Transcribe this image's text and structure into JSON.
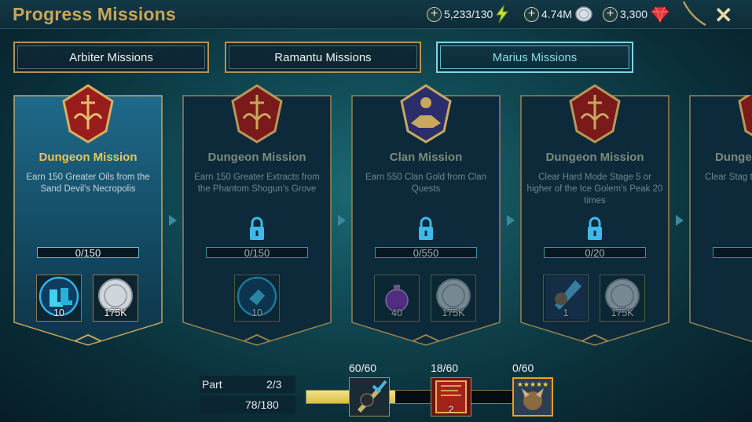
{
  "header": {
    "title": "Progress Missions",
    "close_label": "✕"
  },
  "resources": [
    {
      "value": "5,233/130",
      "icon": "energy-bolt-icon"
    },
    {
      "value": "4.74M",
      "icon": "silver-coin-icon"
    },
    {
      "value": "3,300",
      "icon": "ruby-gem-icon"
    }
  ],
  "tabs": [
    {
      "label": "Arbiter Missions",
      "active": false
    },
    {
      "label": "Ramantu Missions",
      "active": false
    },
    {
      "label": "Marius Missions",
      "active": true
    }
  ],
  "missions": [
    {
      "title": "Dungeon Mission",
      "description": "Earn 150 Greater Oils from the Sand Devil's Necropolis",
      "progress": "0/150",
      "locked": false,
      "emblem": "dungeon-crest-icon",
      "rewards": [
        {
          "icon": "boots-artifact-icon",
          "count": "10"
        },
        {
          "icon": "silver-coin-icon",
          "count": "175K"
        }
      ]
    },
    {
      "title": "Dungeon Mission",
      "description": "Earn 150 Greater Extracts from the Phantom Shogun's Grove",
      "progress": "0/150",
      "locked": true,
      "emblem": "dungeon-crest-icon",
      "rewards": [
        {
          "icon": "gloves-artifact-icon",
          "count": "10"
        }
      ]
    },
    {
      "title": "Clan Mission",
      "description": "Earn 550 Clan Gold from Clan Quests",
      "progress": "0/550",
      "locked": true,
      "emblem": "clan-handshake-crest-icon",
      "rewards": [
        {
          "icon": "purple-potion-icon",
          "count": "40"
        },
        {
          "icon": "silver-coin-icon",
          "count": "175K"
        }
      ]
    },
    {
      "title": "Dungeon Mission",
      "description": "Clear Hard Mode Stage 5 or higher of the Ice Golem's Peak 20 times",
      "progress": "0/20",
      "locked": true,
      "emblem": "dungeon-crest-icon",
      "rewards": [
        {
          "icon": "champion-portrait-icon",
          "count": "1"
        },
        {
          "icon": "silver-coin-icon",
          "count": "175K"
        }
      ]
    },
    {
      "title": "Dunge",
      "description": "Clear Stag the Iron T",
      "progress": "",
      "locked": true,
      "emblem": "dungeon-crest-icon",
      "rewards": []
    }
  ],
  "footer": {
    "part_label": "Part",
    "part_value": "2/3",
    "points": "78/180",
    "milestones": [
      {
        "count": "60/60",
        "icon": "weapon-artifact-icon",
        "badge": "",
        "claimed": true
      },
      {
        "count": "18/60",
        "icon": "red-tome-icon",
        "badge": "2",
        "claimed": false
      },
      {
        "count": "0/60",
        "icon": "five-star-champion-icon",
        "badge": "",
        "claimed": false
      }
    ],
    "fill_fraction": 0.43
  }
}
